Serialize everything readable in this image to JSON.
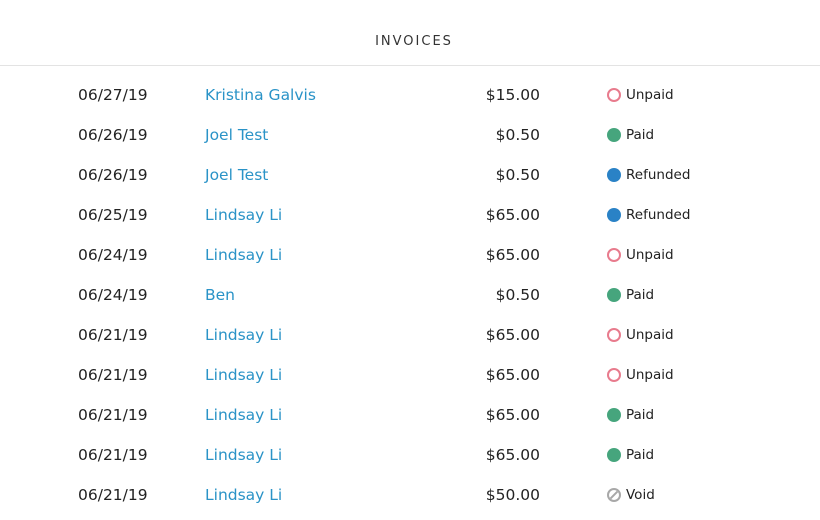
{
  "header": {
    "title": "INVOICES"
  },
  "colors": {
    "link": "#2a93c7",
    "unpaid": "#e87b8d",
    "paid": "#46a57d",
    "refunded": "#2a82c6",
    "void": "#a8a8a8"
  },
  "invoices": [
    {
      "date": "06/27/19",
      "customer": "Kristina Galvis",
      "amount": "$15.00",
      "status": "Unpaid",
      "status_key": "unpaid",
      "icon": "open-circle-icon"
    },
    {
      "date": "06/26/19",
      "customer": "Joel Test",
      "amount": "$0.50",
      "status": "Paid",
      "status_key": "paid",
      "icon": "filled-circle-icon"
    },
    {
      "date": "06/26/19",
      "customer": "Joel Test",
      "amount": "$0.50",
      "status": "Refunded",
      "status_key": "refunded",
      "icon": "filled-circle-icon"
    },
    {
      "date": "06/25/19",
      "customer": "Lindsay Li",
      "amount": "$65.00",
      "status": "Refunded",
      "status_key": "refunded",
      "icon": "filled-circle-icon"
    },
    {
      "date": "06/24/19",
      "customer": "Lindsay Li",
      "amount": "$65.00",
      "status": "Unpaid",
      "status_key": "unpaid",
      "icon": "open-circle-icon"
    },
    {
      "date": "06/24/19",
      "customer": "Ben",
      "amount": "$0.50",
      "status": "Paid",
      "status_key": "paid",
      "icon": "filled-circle-icon"
    },
    {
      "date": "06/21/19",
      "customer": "Lindsay Li",
      "amount": "$65.00",
      "status": "Unpaid",
      "status_key": "unpaid",
      "icon": "open-circle-icon"
    },
    {
      "date": "06/21/19",
      "customer": "Lindsay Li",
      "amount": "$65.00",
      "status": "Unpaid",
      "status_key": "unpaid",
      "icon": "open-circle-icon"
    },
    {
      "date": "06/21/19",
      "customer": "Lindsay Li",
      "amount": "$65.00",
      "status": "Paid",
      "status_key": "paid",
      "icon": "filled-circle-icon"
    },
    {
      "date": "06/21/19",
      "customer": "Lindsay Li",
      "amount": "$65.00",
      "status": "Paid",
      "status_key": "paid",
      "icon": "filled-circle-icon"
    },
    {
      "date": "06/21/19",
      "customer": "Lindsay Li",
      "amount": "$50.00",
      "status": "Void",
      "status_key": "void",
      "icon": "void-circle-icon"
    }
  ]
}
